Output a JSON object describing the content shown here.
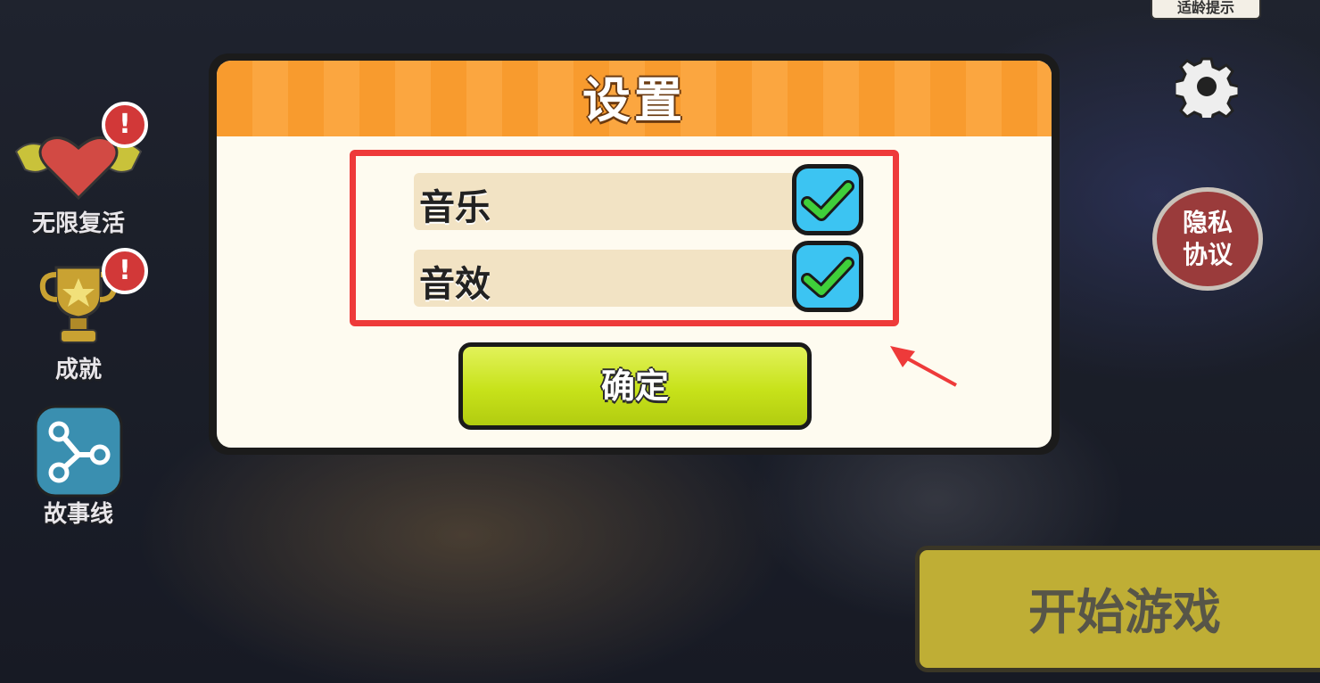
{
  "top_bar": {
    "age_hint": "适龄提示"
  },
  "side_menu": [
    {
      "label": "无限复活",
      "icon": "heart-wings-icon",
      "badge": "!"
    },
    {
      "label": "成就",
      "icon": "trophy-icon",
      "badge": "!"
    },
    {
      "label": "故事线",
      "icon": "storyline-icon"
    }
  ],
  "privacy": {
    "label": "隐私\n协议"
  },
  "start_button": {
    "label": "开始游戏"
  },
  "settings_dialog": {
    "title": "设置",
    "options": [
      {
        "label": "音乐",
        "checked": true
      },
      {
        "label": "音效",
        "checked": true
      }
    ],
    "confirm_label": "确定"
  },
  "colors": {
    "header": "#f89b2e",
    "checkbox": "#3cc4f2",
    "check": "#3fcf3a",
    "highlight": "#ee3a3a",
    "confirm": "#c7e21a"
  }
}
